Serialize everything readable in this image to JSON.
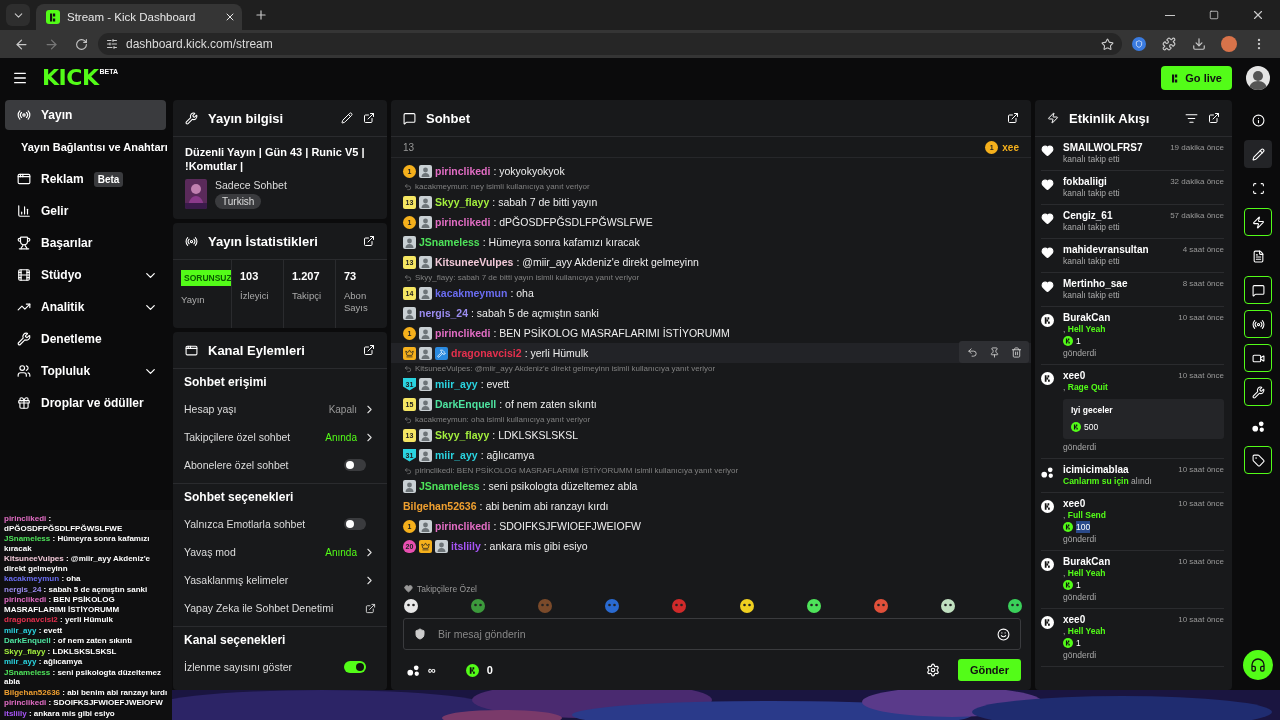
{
  "browser": {
    "tab_title": "Stream - Kick Dashboard",
    "url": "dashboard.kick.com/stream"
  },
  "header": {
    "logo": "KICK",
    "logo_badge": "BETA",
    "go_live": "Go live"
  },
  "sidebar": {
    "items": [
      {
        "label": "Yayın",
        "kind": "live",
        "selected": true,
        "expandable": false
      },
      {
        "label": "Yayın Bağlantısı ve Anahtarı",
        "kind": "sub",
        "selected": false,
        "expandable": false
      },
      {
        "label": "Reklam",
        "kind": "ad",
        "badge": "Beta",
        "selected": false,
        "expandable": false
      },
      {
        "label": "Gelir",
        "kind": "income",
        "selected": false,
        "expandable": false
      },
      {
        "label": "Başarılar",
        "kind": "trophy",
        "selected": false,
        "expandable": false
      },
      {
        "label": "Stüdyo",
        "kind": "studio",
        "selected": false,
        "expandable": true
      },
      {
        "label": "Analitik",
        "kind": "analytics",
        "selected": false,
        "expandable": true
      },
      {
        "label": "Denetleme",
        "kind": "moderation",
        "selected": false,
        "expandable": false
      },
      {
        "label": "Topluluk",
        "kind": "community",
        "selected": false,
        "expandable": true
      },
      {
        "label": "Droplar ve ödüller",
        "kind": "drops",
        "selected": false,
        "expandable": false
      }
    ]
  },
  "stream_overlay": [
    {
      "user": "pirinclikedi",
      "color": "#e26dc4",
      "text": ": dPĞOSDFPĞSDLFPĞWSLFWE"
    },
    {
      "user": "JSnameless",
      "color": "#4ee35a",
      "text": ": Hümeyra sonra kafamızı kıracak"
    },
    {
      "user": "KitsuneeVulpes",
      "color": "#f2c9d8",
      "text": ": @miir_ayy Akdeniz'e direkt gelmeyinn"
    },
    {
      "user": "kacakmeymun",
      "color": "#6a6cf0",
      "text": ": oha"
    },
    {
      "user": "nergis_24",
      "color": "#9b8cf0",
      "text": ": sabah 5 de açmıştın sanki"
    },
    {
      "user": "pirinclikedi",
      "color": "#e26dc4",
      "text": ": BEN PSİKOLOG MASRAFLARIMI İSTİYORUMM"
    },
    {
      "user": "dragonavcisi2",
      "color": "#e5304e",
      "text": ": yerli Hümulk"
    },
    {
      "user": "miir_ayy",
      "color": "#2ad4e0",
      "text": ": evett"
    },
    {
      "user": "DarkEnquell",
      "color": "#4ee3a0",
      "text": ": of nem zaten sıkıntı"
    },
    {
      "user": "Skyy_flayy",
      "color": "#a4f03e",
      "text": ": LDKLSKSLSKSL"
    },
    {
      "user": "miir_ayy",
      "color": "#2ad4e0",
      "text": ": ağlıcamya"
    },
    {
      "user": "JSnameless",
      "color": "#4ee35a",
      "text": ": seni psikologta düzeltemez abla"
    },
    {
      "user": "Bilgehan52636",
      "color": "#f0a030",
      "text": ": abi benim abi ranzayı kırdı"
    },
    {
      "user": "pirinclikedi",
      "color": "#e26dc4",
      "text": ": SDOIFKSJFWIOEFJWEIOFW"
    },
    {
      "user": "itsliily",
      "color": "#a855f7",
      "text": ": ankara mis gibi esiyo"
    }
  ],
  "stream_info": {
    "title": "Yayın bilgisi",
    "stream_title": "Düzenli Yayın | Gün 43 | Runic V5 | !Komutlar |",
    "category": "Sadece Sohbet",
    "tag": "Turkish"
  },
  "stream_stats": {
    "title": "Yayın İstatistikleri",
    "stats": [
      {
        "kind": "status",
        "value": "SORUNSUZ",
        "label": "Yayın"
      },
      {
        "kind": "number",
        "value": "103",
        "label": "İzleyici"
      },
      {
        "kind": "number",
        "value": "1.207",
        "label": "Takipçi"
      },
      {
        "kind": "number",
        "value": "73",
        "label": "Abon Sayıs"
      }
    ]
  },
  "channel_actions": {
    "title": "Kanal Eylemleri",
    "sections": [
      {
        "title": "Sohbet erişimi",
        "rows": [
          {
            "kind": "value",
            "label": "Hesap yaşı",
            "value": "Kapalı",
            "highlight": false
          },
          {
            "kind": "value",
            "label": "Takipçilere özel sohbet",
            "value": "Anında",
            "highlight": true
          },
          {
            "kind": "toggle",
            "label": "Abonelere özel sohbet",
            "on": false
          }
        ]
      },
      {
        "title": "Sohbet seçenekleri",
        "rows": [
          {
            "kind": "toggle",
            "label": "Yalnızca Emotlarla sohbet",
            "on": false
          },
          {
            "kind": "value",
            "label": "Yavaş mod",
            "value": "Anında",
            "highlight": true
          },
          {
            "kind": "arrow",
            "label": "Yasaklanmış kelimeler"
          },
          {
            "kind": "link",
            "label": "Yapay Zeka ile Sohbet Denetimi"
          }
        ]
      },
      {
        "title": "Kanal seçenekleri",
        "rows": [
          {
            "kind": "toggle",
            "label": "İzlenme sayısını göster",
            "on": true
          }
        ]
      }
    ]
  },
  "chat": {
    "title": "Sohbet",
    "pinned": {
      "count": "13",
      "badge": "1",
      "user": "xee"
    },
    "messages": [
      {
        "badges": [
          {
            "kind": "coin",
            "label": "1"
          },
          {
            "kind": "avatar"
          }
        ],
        "user": "pirinclikedi",
        "color": "#e26dc4",
        "text": ": yokyokyokyok",
        "hovered": false
      },
      {
        "reply": "kacakmeymun: ney isimli kullanıcıya yanıt veriyor",
        "badges": [
          {
            "kind": "tier",
            "label": "13"
          },
          {
            "kind": "avatar"
          }
        ],
        "user": "Skyy_flayy",
        "color": "#a4f03e",
        "text": ": sabah 7 de bitti yayın",
        "hovered": false
      },
      {
        "badges": [
          {
            "kind": "coin",
            "label": "1"
          },
          {
            "kind": "avatar"
          }
        ],
        "user": "pirinclikedi",
        "color": "#e26dc4",
        "text": ": dPĞOSDFPĞSDLFPĞWSLFWE",
        "hovered": false
      },
      {
        "badges": [
          {
            "kind": "avatar"
          }
        ],
        "user": "JSnameless",
        "color": "#4ee35a",
        "text": ": Hümeyra sonra kafamızı kıracak",
        "hovered": false
      },
      {
        "badges": [
          {
            "kind": "tier",
            "label": "13"
          },
          {
            "kind": "avatar"
          }
        ],
        "user": "KitsuneeVulpes",
        "color": "#f2c9d8",
        "text": ": @miir_ayy Akdeniz'e direkt gelmeyinn",
        "hovered": false
      },
      {
        "reply": "Skyy_flayy: sabah 7 de bitti yayın isimli kullanıcıya yanıt veriyor",
        "badges": [
          {
            "kind": "tier",
            "label": "14"
          },
          {
            "kind": "avatar"
          }
        ],
        "user": "kacakmeymun",
        "color": "#6a6cf0",
        "text": ": oha",
        "hovered": false
      },
      {
        "badges": [
          {
            "kind": "avatar"
          }
        ],
        "user": "nergis_24",
        "color": "#9b8cf0",
        "text": ": sabah 5 de açmıştın sanki",
        "hovered": false
      },
      {
        "badges": [
          {
            "kind": "coin",
            "label": "1"
          },
          {
            "kind": "avatar"
          }
        ],
        "user": "pirinclikedi",
        "color": "#e26dc4",
        "text": ": BEN PSİKOLOG MASRAFLARIMI İSTİYORUMM",
        "hovered": false
      },
      {
        "badges": [
          {
            "kind": "crown"
          },
          {
            "kind": "avatar"
          },
          {
            "kind": "tool"
          }
        ],
        "user": "dragonavcisi2",
        "color": "#e5304e",
        "text": ": yerli Hümulk",
        "hovered": true
      },
      {
        "reply": "KitsuneeVulpes: @miir_ayy Akdeniz'e direkt gelmeyinn isimli kullanıcıya yanıt veriyor",
        "badges": [
          {
            "kind": "shield",
            "label": "31"
          },
          {
            "kind": "avatar"
          }
        ],
        "user": "miir_ayy",
        "color": "#2ad4e0",
        "text": ": evett",
        "hovered": false
      },
      {
        "badges": [
          {
            "kind": "tier",
            "label": "15"
          },
          {
            "kind": "avatar"
          }
        ],
        "user": "DarkEnquell",
        "color": "#4ee3a0",
        "text": ": of nem zaten sıkıntı",
        "hovered": false
      },
      {
        "reply": "kacakmeymun: oha isimli kullanıcıya yanıt veriyor",
        "badges": [
          {
            "kind": "tier",
            "label": "13"
          },
          {
            "kind": "avatar"
          }
        ],
        "user": "Skyy_flayy",
        "color": "#a4f03e",
        "text": ": LDKLSKSLSKSL",
        "hovered": false
      },
      {
        "badges": [
          {
            "kind": "shield",
            "label": "31"
          },
          {
            "kind": "avatar"
          }
        ],
        "user": "miir_ayy",
        "color": "#2ad4e0",
        "text": ": ağlıcamya",
        "hovered": false
      },
      {
        "reply": "pirinclikedi: BEN PSİKOLOG MASRAFLARIMI İSTİYORUMM isimli kullanıcıya yanıt veriyor",
        "badges": [
          {
            "kind": "avatar"
          }
        ],
        "user": "JSnameless",
        "color": "#4ee35a",
        "text": ": seni psikologta düzeltemez abla",
        "hovered": false
      },
      {
        "user": "Bilgehan52636",
        "color": "#f0a030",
        "text": ": abi benim abi ranzayı kırdı",
        "hovered": false
      },
      {
        "badges": [
          {
            "kind": "coin",
            "label": "1"
          },
          {
            "kind": "avatar"
          }
        ],
        "user": "pirinclikedi",
        "color": "#e26dc4",
        "text": ": SDOIFKSJFWIOEFJWEIOFW",
        "hovered": false
      },
      {
        "badges": [
          {
            "kind": "drop",
            "label": "20"
          },
          {
            "kind": "crown"
          },
          {
            "kind": "avatar"
          }
        ],
        "user": "itsliily",
        "color": "#a855f7",
        "text": ": ankara mis gibi esiyo",
        "hovered": false
      }
    ],
    "followers_only": "Takipçilere Özel",
    "placeholder": "Bir mesaj gönderin",
    "points": "∞",
    "kicks": "0",
    "send": "Gönder"
  },
  "events": {
    "title": "Etkinlik Akışı",
    "items": [
      {
        "kind": "follow",
        "user": "SMAILWOLFRS7",
        "time": "19 dakika önce",
        "action": "kanalı takip etti"
      },
      {
        "kind": "follow",
        "user": "fokbaliigi",
        "time": "32 dakika önce",
        "action": "kanalı takip etti"
      },
      {
        "kind": "follow",
        "user": "Cengiz_61",
        "time": "57 dakika önce",
        "action": "kanalı takip etti"
      },
      {
        "kind": "follow",
        "user": "mahidevransultan",
        "time": "4 saat önce",
        "action": "kanalı takip etti"
      },
      {
        "kind": "follow",
        "user": "Mertinho_sae",
        "time": "8 saat önce",
        "action": "kanalı takip etti"
      },
      {
        "kind": "kicks",
        "user": "BurakCan",
        "time": "10 saat önce",
        "prefix": ",",
        "reward": "Hell Yeah",
        "amount": "1",
        "highlighted": false,
        "action": "gönderdi"
      },
      {
        "kind": "kicks",
        "user": "xee0",
        "time": "10 saat önce",
        "prefix": ",",
        "reward": "Rage Quit",
        "message": "Iyi geceler",
        "amount": "500",
        "highlighted": false,
        "action": "gönderdi"
      },
      {
        "kind": "points",
        "user": "icimicimablaa",
        "time": "10 saat önce",
        "reward": "Canlarım su için",
        "action": "alındı"
      },
      {
        "kind": "kicks",
        "user": "xee0",
        "time": "10 saat önce",
        "prefix": ",",
        "reward": "Full Send",
        "amount": "100",
        "highlighted": true,
        "action": "gönderdi"
      },
      {
        "kind": "kicks",
        "user": "BurakCan",
        "time": "10 saat önce",
        "prefix": ",",
        "reward": "Hell Yeah",
        "amount": "1",
        "highlighted": false,
        "action": "gönderdi"
      },
      {
        "kind": "kicks",
        "user": "xee0",
        "time": "10 saat önce",
        "prefix": ",",
        "reward": "Hell Yeah",
        "amount": "1",
        "highlighted": false,
        "action": "gönderdi"
      }
    ]
  },
  "rail": [
    {
      "kind": "info",
      "selected": false,
      "pinned": false
    },
    {
      "kind": "edit",
      "selected": true,
      "pinned": false
    },
    {
      "kind": "capture",
      "selected": false,
      "pinned": false
    },
    {
      "kind": "bolt",
      "selected": false,
      "pinned": true
    },
    {
      "kind": "notes",
      "selected": false,
      "pinned": false
    },
    {
      "kind": "chat",
      "selected": false,
      "pinned": true
    },
    {
      "kind": "broadcast",
      "selected": false,
      "pinned": true
    },
    {
      "kind": "video",
      "selected": false,
      "pinned": true
    },
    {
      "kind": "tools",
      "selected": false,
      "pinned": true
    },
    {
      "kind": "dots",
      "selected": false,
      "pinned": false
    },
    {
      "kind": "tag",
      "selected": false,
      "pinned": true
    }
  ]
}
